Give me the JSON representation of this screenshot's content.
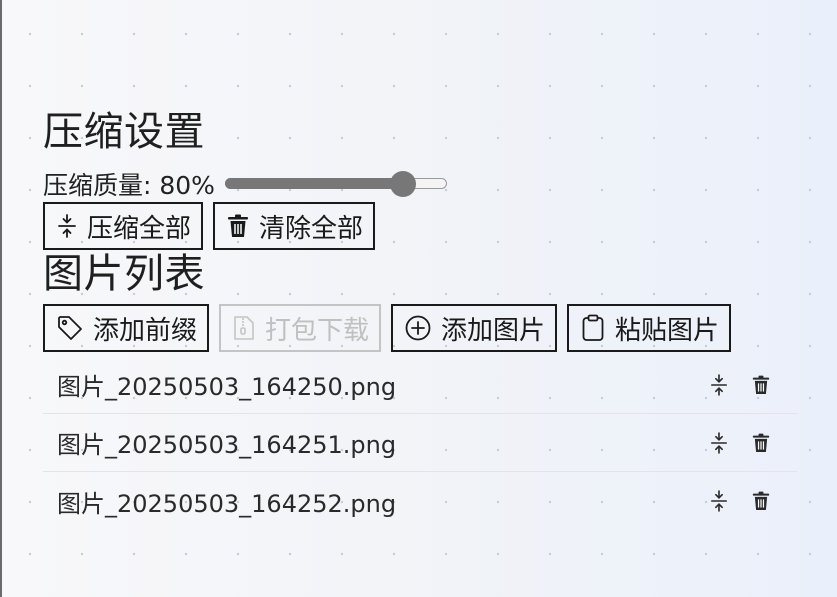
{
  "compress_settings": {
    "title": "压缩设置",
    "quality_label": "压缩质量: 80%",
    "quality_value": 80,
    "compress_all_label": "压缩全部",
    "clear_all_label": "清除全部"
  },
  "image_list": {
    "title": "图片列表",
    "actions": {
      "add_prefix_label": "添加前缀",
      "pack_download_label": "打包下载",
      "add_image_label": "添加图片",
      "paste_image_label": "粘贴图片"
    },
    "files": [
      {
        "name": "图片_20250503_164250.png"
      },
      {
        "name": "图片_20250503_164251.png"
      },
      {
        "name": "图片_20250503_164252.png"
      }
    ]
  },
  "icons": {
    "compress": "compress-icon",
    "trash": "trash-icon",
    "tag": "tag-icon",
    "zip": "zip-file-icon",
    "add": "plus-circle-icon",
    "clipboard": "clipboard-icon"
  },
  "colors": {
    "border": "#1a1a1a",
    "disabled": "#c0c0c0",
    "slider": "#777777"
  }
}
